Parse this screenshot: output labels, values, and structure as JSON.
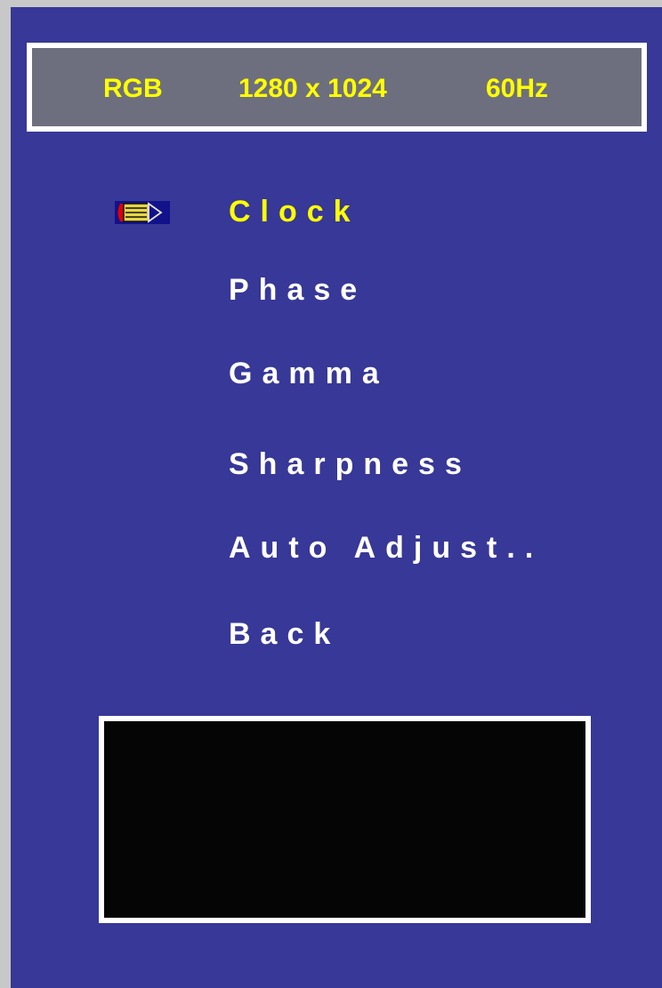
{
  "header": {
    "signal": "RGB",
    "resolution": "1280 x 1024",
    "refresh": "60Hz"
  },
  "menu": {
    "selected_index": 0,
    "items": [
      {
        "label": "Clock"
      },
      {
        "label": "Phase"
      },
      {
        "label": "Gamma"
      },
      {
        "label": "Sharpness"
      },
      {
        "label": "Auto Adjust.."
      },
      {
        "label": "Back"
      }
    ]
  },
  "cursor_icon": "pencil-icon",
  "colors": {
    "background": "#373897",
    "header_bg": "#6e6f7e",
    "highlight": "#ffff00",
    "text": "#ffffff",
    "preview_bg": "#050505"
  }
}
